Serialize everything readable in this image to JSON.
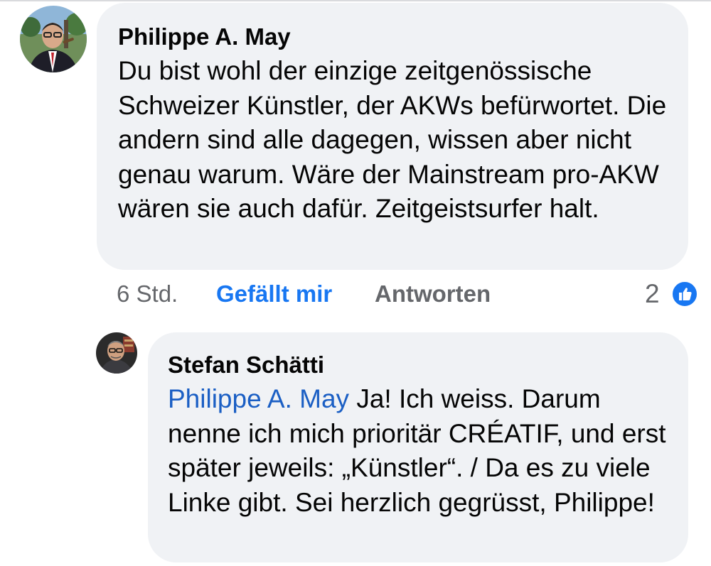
{
  "comment": {
    "author": "Philippe A. May",
    "avatar_icon": "profile-photo-avatar",
    "text": "Du bist wohl der einzige zeitgenössische Schweizer Künstler, der AKWs befürwortet. Die andern sind alle dagegen, wissen aber nicht genau warum. Wäre der Mainstream pro-AKW wären sie auch dafür. Zeitgeistsurfer halt.",
    "time": "6 Std.",
    "like_label": "Gefällt mir",
    "reply_label": "Antworten",
    "reaction_count": "2",
    "reaction_icon": "thumbs-up-icon"
  },
  "reply": {
    "author": "Stefan Schätti",
    "avatar_icon": "profile-photo-avatar",
    "mention": "Philippe A. May",
    "text": "Ja! Ich weiss. Darum nenne ich mich prioritär CRÉATIF, und erst später jeweils: „Künstler“. / Da es zu viele Linke gibt.  Sei herzlich gegrüsst, Philippe!"
  },
  "colors": {
    "bubble_background": "#f0f2f5",
    "link_blue": "#1877f2",
    "mention_blue": "#1b5fc4",
    "meta_gray": "#65676b",
    "text": "#050505"
  }
}
